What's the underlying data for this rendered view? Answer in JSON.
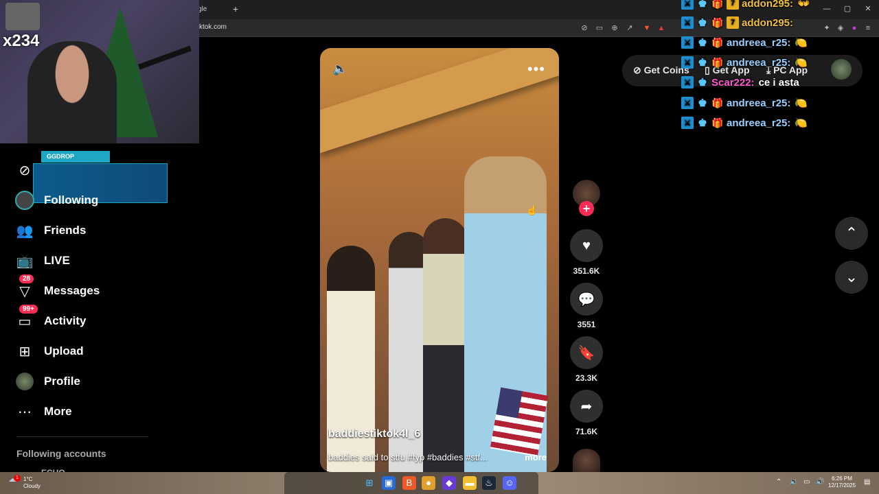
{
  "browser": {
    "tab_title": "gle",
    "new_tab": "+",
    "url": "ktok.com",
    "window_controls": [
      "—",
      "▢",
      "✕"
    ]
  },
  "webcam": {
    "sub_count": "x234"
  },
  "ggdrop": {
    "label": "GGDROP"
  },
  "sidebar": {
    "items": [
      {
        "label": "Following",
        "icon": "compass-icon"
      },
      {
        "label": "Friends",
        "icon": "friends-icon"
      },
      {
        "label": "LIVE",
        "icon": "live-icon"
      },
      {
        "label": "Messages",
        "icon": "messages-icon",
        "badge": "28"
      },
      {
        "label": "Activity",
        "icon": "activity-icon",
        "badge": "99+"
      },
      {
        "label": "Upload",
        "icon": "upload-icon"
      },
      {
        "label": "Profile",
        "icon": "profile-icon"
      },
      {
        "label": "More",
        "icon": "more-icon"
      }
    ],
    "following_title": "Following accounts",
    "following_partial": "ECHO"
  },
  "top_pill": {
    "get_coins": "Get Coins",
    "get_app": "Get App",
    "pc_app": "PC App"
  },
  "video": {
    "handle": "baddiestiktok4l_6",
    "description": "baddies said to stfu #fyp #baddies #stf...",
    "more": "more"
  },
  "actions": {
    "likes": "351.6K",
    "comments": "3551",
    "saves": "23.3K",
    "shares": "71.6K"
  },
  "chat": [
    {
      "user": "addon295:",
      "msg": "",
      "color": "#f0c040"
    },
    {
      "user": "addon295:",
      "msg": "",
      "color": "#f0c040"
    },
    {
      "user": "andreea_r25:",
      "msg": "",
      "color": "#9ad0ff"
    },
    {
      "user": "andreea_r25:",
      "msg": "",
      "color": "#9ad0ff"
    },
    {
      "user": "Scar222:",
      "msg": "ce i asta",
      "color": "#ff5ad0"
    },
    {
      "user": "andreea_r25:",
      "msg": "",
      "color": "#9ad0ff"
    },
    {
      "user": "andreea_r25:",
      "msg": "",
      "color": "#9ad0ff"
    }
  ],
  "taskbar": {
    "temp": "1°C",
    "condition": "Cloudy",
    "weather_badge": "1",
    "time": "6:26 PM",
    "date": "12/17/2025"
  },
  "colors": {
    "accent": "#fe2c55",
    "background": "#000000",
    "action_bg": "#2f2f2f"
  }
}
